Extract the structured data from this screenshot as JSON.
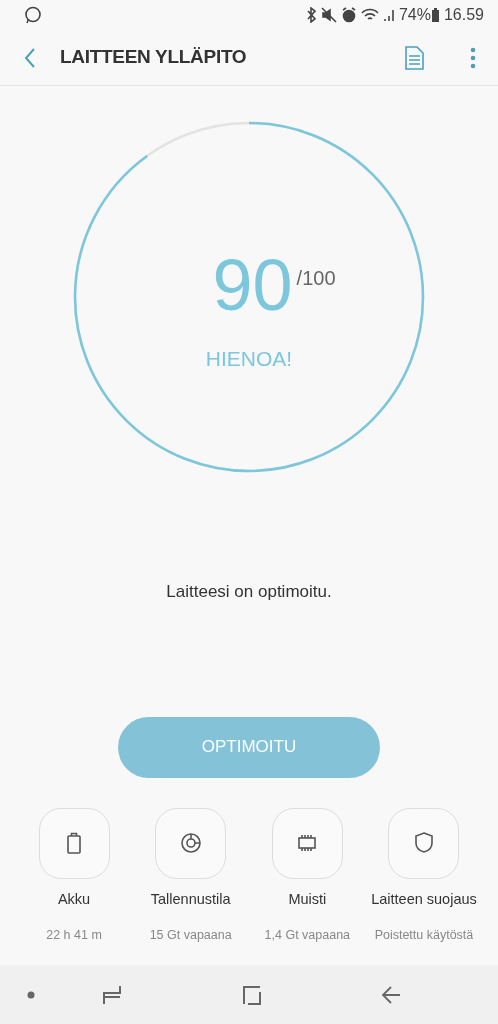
{
  "status_bar": {
    "battery": "74%",
    "time": "16.59"
  },
  "app_bar": {
    "title": "LAITTEEN YLLÄPITO"
  },
  "score": {
    "value": "90",
    "max": "/100",
    "rating": "HIENOA!"
  },
  "message": "Laitteesi on optimoitu.",
  "optimize_button": {
    "label": "OPTIMOITU",
    "disabled": true
  },
  "categories": [
    {
      "kind": "battery",
      "label": "Akku",
      "detail": "22 h 41 m"
    },
    {
      "kind": "storage",
      "label": "Tallennustila",
      "detail": "15 Gt vapaana"
    },
    {
      "kind": "memory",
      "label": "Muisti",
      "detail": "1,4 Gt vapaana"
    },
    {
      "kind": "security",
      "label": "Laitteen suojaus",
      "detail": "Poistettu käytöstä"
    }
  ]
}
